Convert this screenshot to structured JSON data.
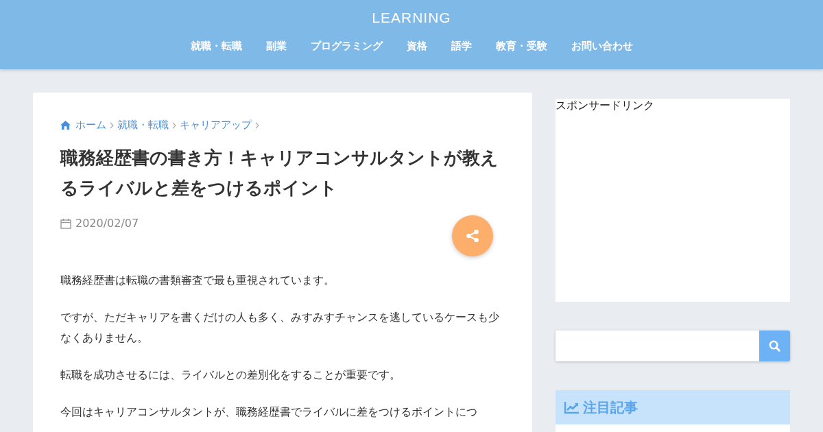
{
  "site": {
    "title": "LEARNING"
  },
  "nav": [
    {
      "label": "就職・転職"
    },
    {
      "label": "副業"
    },
    {
      "label": "プログラミング"
    },
    {
      "label": "資格"
    },
    {
      "label": "語学"
    },
    {
      "label": "教育・受験"
    },
    {
      "label": "お問い合わせ"
    }
  ],
  "breadcrumb": [
    "ホーム",
    "就職・転職",
    "キャリアアップ"
  ],
  "article": {
    "title": "職務経歴書の書き方！キャリアコンサルタントが教えるライバルと差をつけるポイント",
    "date": "2020/02/07",
    "paragraphs": [
      "職務経歴書は転職の書類審査で最も重視されています。",
      "ですが、ただキャリアを書くだけの人も多く、みすみすチャンスを逃しているケースも少なくありません。",
      "転職を成功させるには、ライバルとの差別化をすることが重要です。",
      "今回はキャリアコンサルタントが、職務経歴書でライバルに差をつけるポイントにつ"
    ]
  },
  "sidebar": {
    "ad_label": "スポンサードリンク",
    "widget_title": "注目記事"
  }
}
